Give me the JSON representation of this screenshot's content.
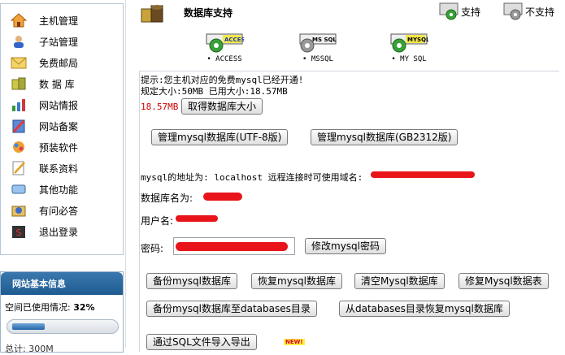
{
  "sidebar": {
    "items": [
      {
        "label": "主机管理",
        "icon": "home-icon"
      },
      {
        "label": "子站管理",
        "icon": "subsite-icon"
      },
      {
        "label": "免费邮局",
        "icon": "mail-icon"
      },
      {
        "label": "数 据 库",
        "icon": "database-icon"
      },
      {
        "label": "网站情报",
        "icon": "stats-icon"
      },
      {
        "label": "网站备案",
        "icon": "record-icon"
      },
      {
        "label": "预装软件",
        "icon": "software-icon"
      },
      {
        "label": "联系资料",
        "icon": "contact-icon"
      },
      {
        "label": "其他功能",
        "icon": "other-icon"
      },
      {
        "label": "有问必答",
        "icon": "help-icon"
      },
      {
        "label": "退出登录",
        "icon": "logout-icon"
      }
    ],
    "info": {
      "title": "网站基本信息",
      "usage_label": "空间已使用情况:",
      "usage_value": "32%",
      "usage_fraction": 0.32,
      "cut_text": "总计: 300M"
    }
  },
  "header": {
    "title": "数据库支持",
    "support_label": "支持",
    "nosupport_label": "不支持"
  },
  "db_types": [
    {
      "chip": "ACCESS",
      "label": "• ACCESS",
      "supported": true
    },
    {
      "chip": "MS SQL",
      "label": "• MSSQL",
      "supported": false
    },
    {
      "chip": "MYSQL",
      "label": "• MY SQL",
      "supported": true
    }
  ],
  "panel": {
    "notice": "提示:您主机对应的免费mysql已经开通!",
    "size_info": "规定大小:50MB 已用大小:18.57MB",
    "size_value": "18.57MB",
    "get_size_button": "取得数据库大小",
    "manage_utf8_button": "管理mysql数据库(UTF-8版)",
    "manage_gb_button": "管理mysql数据库(GB2312版)",
    "address_text": "mysql的地址为: localhost 远程连接时可使用域名:",
    "dbname_label": "数据库名为:",
    "username_label": "用户名:",
    "password_label": "密码:",
    "change_password_button": "修改mysql密码",
    "backup_button": "备份mysql数据库",
    "restore_button": "恢复mysql数据库",
    "clear_button": "清空Mysql数据库",
    "repair_button": "修复Mysql数据表",
    "backup_to_dir_button": "备份mysql数据库至databases目录",
    "restore_from_dir_button": "从databases目录恢复mysql数据库",
    "import_sql_button": "通过SQL文件导入导出",
    "new_badge": "NEW!"
  },
  "colors": {
    "accent_red": "#e8141a",
    "header_blue": "#1f5b92",
    "size_red": "#cc0000"
  }
}
